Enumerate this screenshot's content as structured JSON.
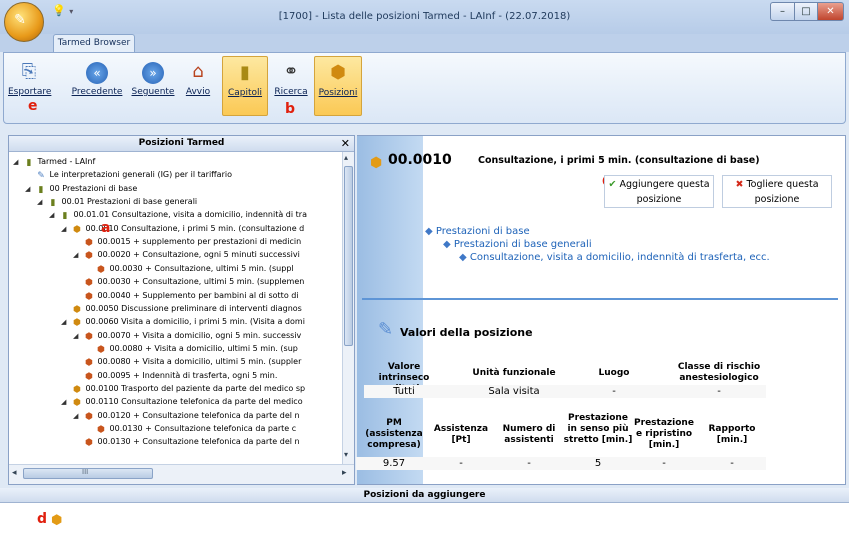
{
  "window": {
    "title": "[1700] -  Lista delle posizioni Tarmed - LAInf - (22.07.2018)",
    "minimize_symbol": "–",
    "maximize_symbol": "□",
    "close_symbol": "✕"
  },
  "tab": {
    "label": "Tarmed Browser"
  },
  "ribbon": {
    "buttons": [
      {
        "label": "Esportare",
        "icon": "export-icon"
      },
      {
        "label": "Precedente",
        "icon": "back-arrow-icon"
      },
      {
        "label": "Seguente",
        "icon": "forward-arrow-icon"
      },
      {
        "label": "Avvio",
        "icon": "home-icon"
      },
      {
        "label": "Capitoli",
        "icon": "chapters-book-icon",
        "active": true
      },
      {
        "label": "Ricerca",
        "icon": "binoculars-icon"
      },
      {
        "label": "Posizioni",
        "icon": "positions-cube-icon",
        "active": true
      }
    ],
    "marker_e": "e",
    "marker_b": "b"
  },
  "left_panel": {
    "title": "Posizioni Tarmed",
    "close_symbol": "✕",
    "marker_a": "a",
    "tree": [
      {
        "level": 0,
        "exp": "◢",
        "icon": "book",
        "text": "Tarmed - LAInf"
      },
      {
        "level": 1,
        "exp": "",
        "icon": "ig",
        "text": "Le interpretazioni generali (IG) per il tariffario"
      },
      {
        "level": 1,
        "exp": "◢",
        "icon": "book",
        "text": "00 Prestazioni di base"
      },
      {
        "level": 2,
        "exp": "◢",
        "icon": "book",
        "text": "00.01 Prestazioni di base generali"
      },
      {
        "level": 3,
        "exp": "◢",
        "icon": "book",
        "text": "00.01.01 Consultazione, visita a domicilio, indennità di tra"
      },
      {
        "level": 4,
        "exp": "◢",
        "icon": "cube",
        "text": "00.0010 Consultazione, i primi 5 min. (consultazione d"
      },
      {
        "level": 5,
        "exp": "",
        "icon": "plus",
        "text": "00.0015 + supplemento per prestazioni di medicin"
      },
      {
        "level": 5,
        "exp": "◢",
        "icon": "plus",
        "text": "00.0020 + Consultazione, ogni 5 minuti successivi"
      },
      {
        "level": 6,
        "exp": "",
        "icon": "plus",
        "text": "00.0030 + Consultazione, ultimi 5 min. (suppl"
      },
      {
        "level": 5,
        "exp": "",
        "icon": "plus",
        "text": "00.0030 + Consultazione, ultimi 5 min. (supplemen"
      },
      {
        "level": 5,
        "exp": "",
        "icon": "plus",
        "text": "00.0040 + Supplemento per bambini al di sotto di"
      },
      {
        "level": 4,
        "exp": "",
        "icon": "cube",
        "text": "00.0050 Discussione preliminare di interventi diagnos"
      },
      {
        "level": 4,
        "exp": "◢",
        "icon": "cube",
        "text": "00.0060 Visita a domicilio, i primi 5 min. (Visita a domi"
      },
      {
        "level": 5,
        "exp": "◢",
        "icon": "plus",
        "text": "00.0070 + Visita a domicilio, ogni 5 min. successiv"
      },
      {
        "level": 6,
        "exp": "",
        "icon": "plus",
        "text": "00.0080 + Visita a domicilio, ultimi 5 min. (sup"
      },
      {
        "level": 5,
        "exp": "",
        "icon": "plus",
        "text": "00.0080 + Visita a domicilio, ultimi 5 min. (suppler"
      },
      {
        "level": 5,
        "exp": "",
        "icon": "plus",
        "text": "00.0095 + Indennità di trasferta, ogni 5 min."
      },
      {
        "level": 4,
        "exp": "",
        "icon": "cube",
        "text": "00.0100 Trasporto del paziente da parte del medico sp"
      },
      {
        "level": 4,
        "exp": "◢",
        "icon": "cube",
        "text": "00.0110 Consultazione telefonica da parte del medico"
      },
      {
        "level": 5,
        "exp": "◢",
        "icon": "plus",
        "text": "00.0120 + Consultazione telefonica da parte del n"
      },
      {
        "level": 6,
        "exp": "",
        "icon": "plus",
        "text": "00.0130 + Consultazione telefonica da parte c"
      },
      {
        "level": 5,
        "exp": "",
        "icon": "plus",
        "text": "00.0130 + Consultazione telefonica da parte del n"
      }
    ],
    "hscroll_left": "◂",
    "hscroll_right": "▸",
    "hscroll_grip": "III",
    "vscroll_up": "▴",
    "vscroll_down": "▾"
  },
  "detail": {
    "code": "00.0010",
    "description": "Consultazione, i primi 5 min. (consultazione di base)",
    "marker_c": "C",
    "add_button": {
      "icon": "✔",
      "label": "Aggiungere questa posizione"
    },
    "remove_button": {
      "icon": "✖",
      "label": "Togliere questa posizione"
    },
    "breadcrumbs": [
      "Prestazioni di base",
      "Prestazioni di base generali",
      "Consultazione, visita a domicilio, indennità di trasferta, ecc."
    ],
    "values_title": "Valori della posizione",
    "table1": {
      "headers": [
        "Valore intrinseco qualitativo",
        "Unità funzionale",
        "Luogo",
        "Classe di rischio anestesiologico"
      ],
      "values": [
        "Tutti",
        "Sala visita",
        "-",
        "-"
      ]
    },
    "table2": {
      "headers": [
        "PM (assistenza compresa)",
        "Assistenza [Pt]",
        "Numero di assistenti",
        "Prestazione in senso più stretto [min.]",
        "Prestazione e ripristino [min.]",
        "Rapporto [min.]"
      ],
      "values": [
        "9.57",
        "-",
        "-",
        "5",
        "-",
        "-"
      ]
    }
  },
  "bottom": {
    "title": "Posizioni da aggiungere",
    "marker_d": "d"
  },
  "colors": {
    "accent": "#1d62b8",
    "marker": "#e0200e",
    "active_button": "#fbc955"
  }
}
